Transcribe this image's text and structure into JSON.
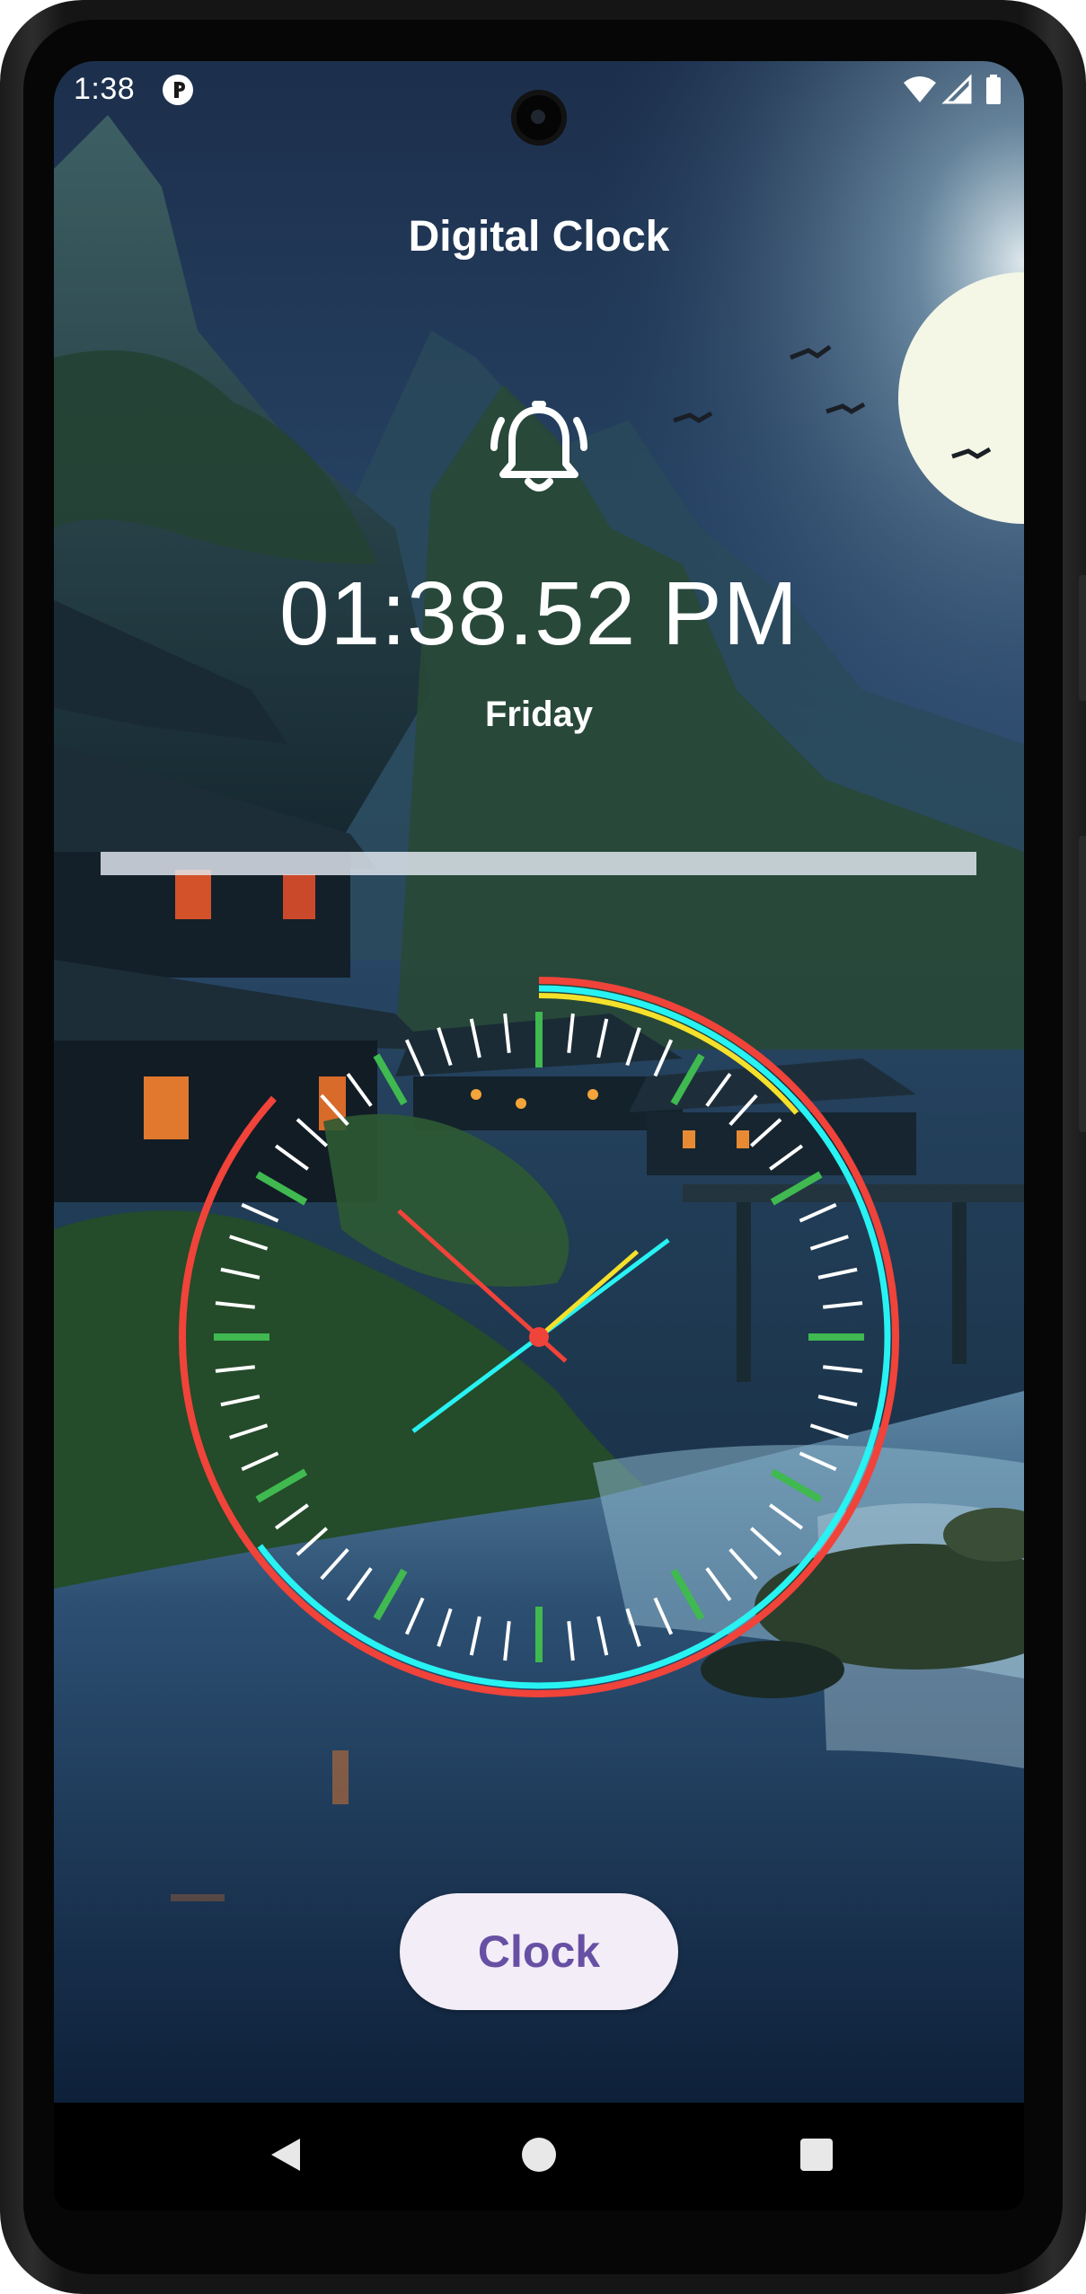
{
  "status_bar": {
    "time": "1:38",
    "app_icon": "app-notification-icon",
    "wifi_icon": "wifi-icon",
    "signal_icon": "cellular-signal-icon",
    "battery_icon": "battery-icon"
  },
  "app": {
    "title": "Digital Clock",
    "bell_icon": "alarm-bell-icon",
    "digital_time": "01:38.52 PM",
    "day": "Friday",
    "seconds_progress": 1.0,
    "button_label": "Clock"
  },
  "analog_clock": {
    "hour": 1,
    "minute": 38,
    "second": 52,
    "colors": {
      "outer_ring": "#f0433a",
      "minute_ring": "#28f2f2",
      "hour_ring": "#f5e12a",
      "major_tick": "#3fb950",
      "minor_tick": "#ffffff",
      "hour_hand": "#f5e12a",
      "minute_hand": "#28f2f2",
      "second_hand": "#f0433a",
      "center_dot": "#f0433a"
    }
  },
  "nav_bar": {
    "back_icon": "back-triangle-icon",
    "home_icon": "home-circle-icon",
    "recents_icon": "recents-square-icon"
  },
  "colors": {
    "button_bg": "#f3edf7",
    "button_text": "#6750a4"
  }
}
